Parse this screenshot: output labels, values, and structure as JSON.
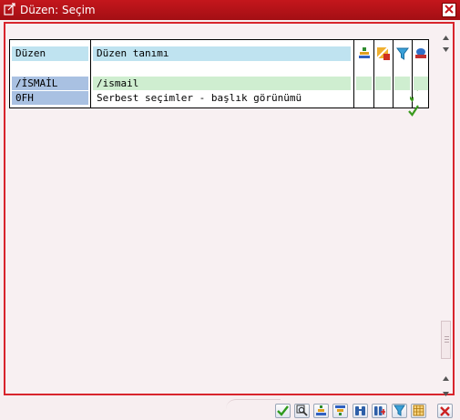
{
  "window": {
    "title": "Düzen: Seçim"
  },
  "grid": {
    "columns": [
      "Düzen",
      "Düzen tanımı"
    ],
    "rows": [
      {
        "layout": "/İSMAİL",
        "description": "/ismail",
        "default_check": true
      },
      {
        "layout": "0FH",
        "description": "Serbest seçimler - başlık görünümü",
        "default_check": true
      }
    ]
  },
  "icons": {
    "title": "window-icon",
    "close": "close-icon",
    "col_default": "default-layout-icon",
    "col_user": "user-specific-icon",
    "col_filter": "filter-icon",
    "col_save": "save-settings-icon",
    "check": "checkmark-icon"
  },
  "toolbar": {
    "buttons": [
      "confirm",
      "find",
      "sort-ascending",
      "sort-descending",
      "find-first",
      "find-next",
      "filter",
      "layout",
      "cancel"
    ]
  },
  "colors": {
    "title_bar": "#c4161c",
    "border": "#d8242c",
    "header": "#bfe3f0",
    "key_cell": "#a9c1e2",
    "row_green": "#cfeed0",
    "check": "#3a9a1e",
    "cancel": "#cc2222"
  }
}
